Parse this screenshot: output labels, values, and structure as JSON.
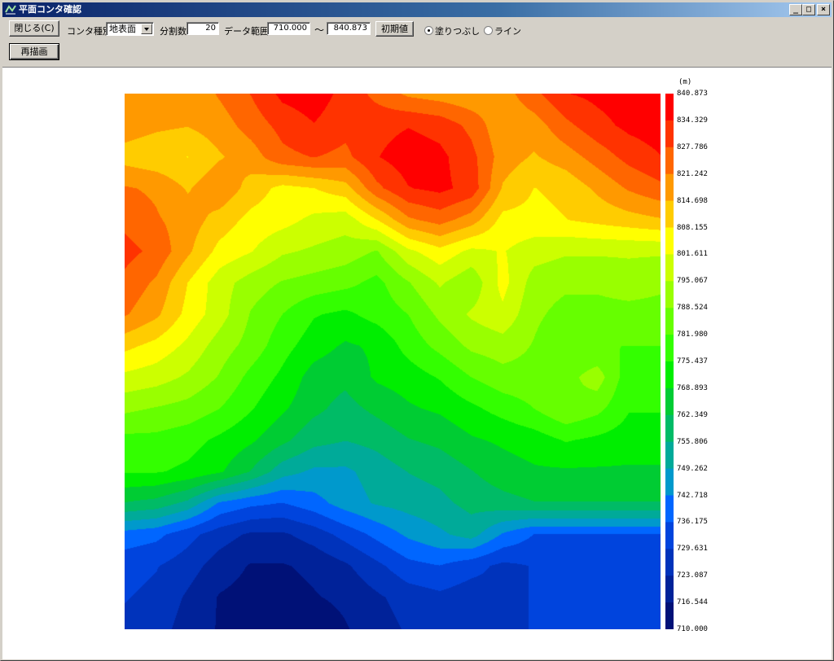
{
  "window": {
    "title": "平面コンタ確認",
    "min_label": "_",
    "max_label": "□",
    "close_label": "×"
  },
  "toolbar": {
    "close_label": "閉じる(C)",
    "contour_type_label": "コンタ種別",
    "contour_type_value": "地表面",
    "divisions_label": "分割数",
    "divisions_value": "20",
    "range_label": "データ範囲",
    "range_min": "710.000",
    "range_sep": "～",
    "range_max": "840.873",
    "default_label": "初期値",
    "fill_label": "塗りつぶし",
    "line_label": "ライン",
    "fill_selected": true,
    "redraw_label": "再描画"
  },
  "chart_data": {
    "type": "heatmap",
    "title": "",
    "unit": "(m)",
    "xlabel": "",
    "ylabel": "",
    "range": [
      710.0,
      840.873
    ],
    "levels": 20,
    "colorbar_ticks": [
      "840.873",
      "834.329",
      "827.786",
      "821.242",
      "814.698",
      "808.155",
      "801.611",
      "795.067",
      "788.524",
      "781.980",
      "775.437",
      "768.893",
      "762.349",
      "755.806",
      "749.262",
      "742.718",
      "736.175",
      "729.631",
      "723.087",
      "716.544",
      "710.000"
    ],
    "colors": [
      "#ff0000",
      "#ff3300",
      "#ff6600",
      "#ff9900",
      "#ffcc00",
      "#ffff00",
      "#ccff00",
      "#99ff00",
      "#66ff00",
      "#33ff00",
      "#00ee00",
      "#00cc33",
      "#00bb66",
      "#00aa99",
      "#0099cc",
      "#0066ff",
      "#0044dd",
      "#0033bb",
      "#002299",
      "#001177"
    ],
    "grid_values": [
      [
        820,
        818,
        816,
        822,
        828,
        836,
        838,
        832,
        826,
        820,
        818,
        816,
        818,
        826,
        834,
        836,
        838,
        838
      ],
      [
        818,
        816,
        815,
        818,
        824,
        830,
        834,
        830,
        832,
        834,
        832,
        826,
        816,
        818,
        826,
        832,
        836,
        838
      ],
      [
        812,
        810,
        808,
        814,
        818,
        826,
        828,
        826,
        834,
        838,
        836,
        830,
        818,
        814,
        818,
        824,
        830,
        834
      ],
      [
        822,
        820,
        814,
        820,
        812,
        806,
        808,
        812,
        826,
        834,
        836,
        832,
        814,
        808,
        810,
        816,
        822,
        826
      ],
      [
        826,
        822,
        818,
        812,
        806,
        804,
        800,
        798,
        808,
        820,
        824,
        818,
        806,
        806,
        808,
        810,
        812,
        814
      ],
      [
        830,
        826,
        816,
        806,
        802,
        796,
        794,
        792,
        788,
        800,
        806,
        800,
        802,
        798,
        796,
        796,
        796,
        796
      ],
      [
        826,
        820,
        808,
        798,
        792,
        788,
        786,
        784,
        780,
        788,
        796,
        790,
        804,
        792,
        790,
        790,
        792,
        790
      ],
      [
        822,
        816,
        806,
        798,
        788,
        782,
        776,
        774,
        778,
        782,
        790,
        796,
        800,
        790,
        786,
        786,
        786,
        786
      ],
      [
        810,
        806,
        800,
        792,
        786,
        778,
        772,
        768,
        770,
        778,
        784,
        790,
        792,
        788,
        782,
        782,
        782,
        782
      ],
      [
        800,
        798,
        794,
        788,
        780,
        774,
        766,
        764,
        770,
        772,
        776,
        782,
        786,
        786,
        786,
        792,
        778,
        778
      ],
      [
        790,
        788,
        786,
        782,
        776,
        770,
        764,
        760,
        764,
        768,
        770,
        774,
        778,
        782,
        788,
        784,
        776,
        776
      ],
      [
        780,
        780,
        778,
        774,
        770,
        764,
        758,
        756,
        758,
        762,
        764,
        768,
        770,
        772,
        776,
        774,
        772,
        772
      ],
      [
        776,
        776,
        774,
        770,
        762,
        752,
        748,
        748,
        752,
        756,
        758,
        762,
        766,
        768,
        768,
        768,
        768,
        768
      ],
      [
        762,
        760,
        754,
        742,
        738,
        736,
        740,
        746,
        750,
        752,
        754,
        758,
        760,
        762,
        762,
        762,
        762,
        762
      ],
      [
        740,
        738,
        732,
        726,
        722,
        722,
        726,
        732,
        738,
        744,
        748,
        752,
        742,
        736,
        736,
        736,
        736,
        736
      ],
      [
        732,
        730,
        726,
        720,
        716,
        716,
        718,
        722,
        728,
        734,
        736,
        732,
        728,
        730,
        730,
        730,
        730,
        730
      ],
      [
        730,
        728,
        722,
        716,
        714,
        714,
        716,
        718,
        722,
        726,
        728,
        726,
        728,
        730,
        730,
        730,
        730,
        730
      ],
      [
        728,
        726,
        720,
        716,
        714,
        712,
        712,
        716,
        720,
        724,
        726,
        726,
        728,
        730,
        730,
        730,
        730,
        730
      ]
    ]
  }
}
